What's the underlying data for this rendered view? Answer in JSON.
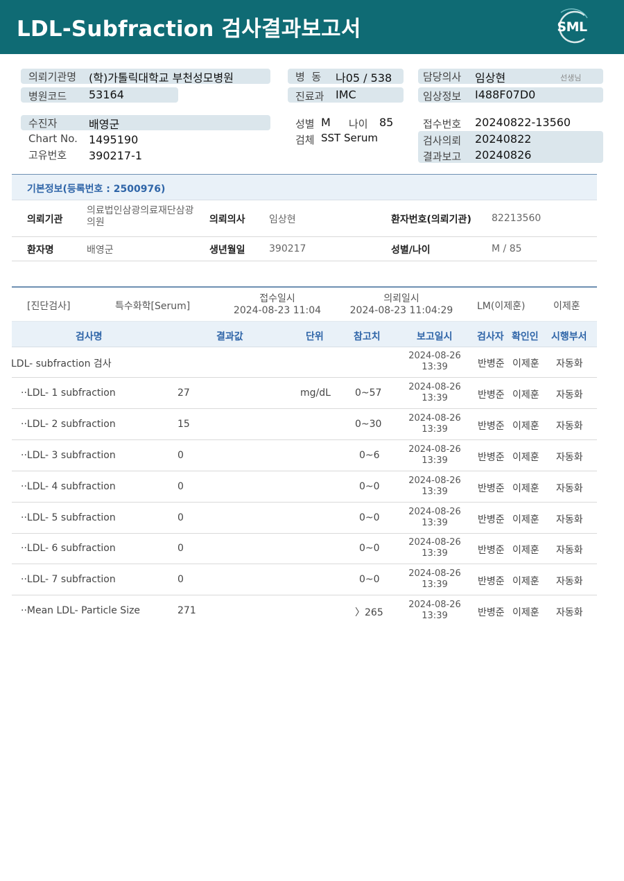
{
  "report": {
    "title": "LDL-Subfraction 검사결과보고서",
    "logo_text": "SML"
  },
  "header": {
    "hospital_label": "의뢰기관명",
    "hospital_value": "(학)가톨릭대학교 부천성모병원",
    "code_label": "병원코드",
    "code_value": "53164",
    "ward_label": "병  동",
    "ward_value": "나05 / 538",
    "dept_label": "진료과",
    "dept_value": "IMC",
    "doctor_label": "담당의사",
    "doctor_value": "임상현",
    "doctor_suffix": "선생님",
    "clinical_label": "임상정보",
    "clinical_value": "I488F07D0",
    "patient_label": "수진자",
    "patient_value": "배영군",
    "chart_label": "Chart No.",
    "chart_value": "1495190",
    "unique_label": "고유번호",
    "unique_value": "390217-1",
    "sex_label": "성별",
    "sex_value": "M",
    "age_label": "나이",
    "age_value": "85",
    "specimen_label": "검체",
    "specimen_value": "SST Serum",
    "receipt_label": "접수번호",
    "receipt_value": "20240822-13560",
    "request_label": "검사의뢰",
    "request_value": "20240822",
    "result_label": "결과보고",
    "result_value": "20240826"
  },
  "basic_info": {
    "title": "기본정보(등록번호 : 2500976)",
    "inst_label": "의뢰기관",
    "inst_value": "의료법인삼광의료재단삼광의원",
    "req_doctor_label": "의뢰의사",
    "req_doctor_value": "임상현",
    "patient_no_label": "환자번호(의뢰기관)",
    "patient_no_value": "82213560",
    "name_label": "환자명",
    "name_value": "배영군",
    "birth_label": "생년월일",
    "birth_value": "390217",
    "sexage_label": "성별/나이",
    "sexage_value": "M / 85"
  },
  "diagnosis": {
    "category": "[진단검사]",
    "type": "특수화학[Serum]",
    "receipt_label": "접수일시",
    "receipt_value": "2024-08-23 11:04",
    "request_label": "의뢰일시",
    "request_value": "2024-08-23 11:04:29",
    "lm": "LM(이제훈)",
    "confirmer": "이제훈"
  },
  "table": {
    "headers": {
      "name": "검사명",
      "result": "결과값",
      "unit": "단위",
      "ref": "참고치",
      "report_date": "보고일시",
      "tester": "검사자",
      "confirmer": "확인인",
      "dept": "시행부서"
    },
    "rows": [
      {
        "name": "LDL- subfraction 검사",
        "result": "",
        "unit": "",
        "ref": "",
        "date": "2024-08-26",
        "time": "13:39",
        "tester": "반병준",
        "confirmer": "이제훈",
        "dept": "자동화"
      },
      {
        "name": "··LDL- 1 subfraction",
        "result": "27",
        "unit": "mg/dL",
        "ref": "0~57",
        "date": "2024-08-26",
        "time": "13:39",
        "tester": "반병준",
        "confirmer": "이제훈",
        "dept": "자동화"
      },
      {
        "name": "··LDL- 2 subfraction",
        "result": "15",
        "unit": "",
        "ref": "0~30",
        "date": "2024-08-26",
        "time": "13:39",
        "tester": "반병준",
        "confirmer": "이제훈",
        "dept": "자동화"
      },
      {
        "name": "··LDL- 3 subfraction",
        "result": "0",
        "unit": "",
        "ref": "0~6",
        "date": "2024-08-26",
        "time": "13:39",
        "tester": "반병준",
        "confirmer": "이제훈",
        "dept": "자동화"
      },
      {
        "name": "··LDL- 4 subfraction",
        "result": "0",
        "unit": "",
        "ref": "0~0",
        "date": "2024-08-26",
        "time": "13:39",
        "tester": "반병준",
        "confirmer": "이제훈",
        "dept": "자동화"
      },
      {
        "name": "··LDL- 5 subfraction",
        "result": "0",
        "unit": "",
        "ref": "0~0",
        "date": "2024-08-26",
        "time": "13:39",
        "tester": "반병준",
        "confirmer": "이제훈",
        "dept": "자동화"
      },
      {
        "name": "··LDL- 6 subfraction",
        "result": "0",
        "unit": "",
        "ref": "0~0",
        "date": "2024-08-26",
        "time": "13:39",
        "tester": "반병준",
        "confirmer": "이제훈",
        "dept": "자동화"
      },
      {
        "name": "··LDL- 7 subfraction",
        "result": "0",
        "unit": "",
        "ref": "0~0",
        "date": "2024-08-26",
        "time": "13:39",
        "tester": "반병준",
        "confirmer": "이제훈",
        "dept": "자동화"
      },
      {
        "name": "··Mean LDL- Particle Size",
        "result": "271",
        "unit": "",
        "ref": "〉265",
        "date": "2024-08-26",
        "time": "13:39",
        "tester": "반병준",
        "confirmer": "이제훈",
        "dept": "자동화"
      }
    ]
  }
}
